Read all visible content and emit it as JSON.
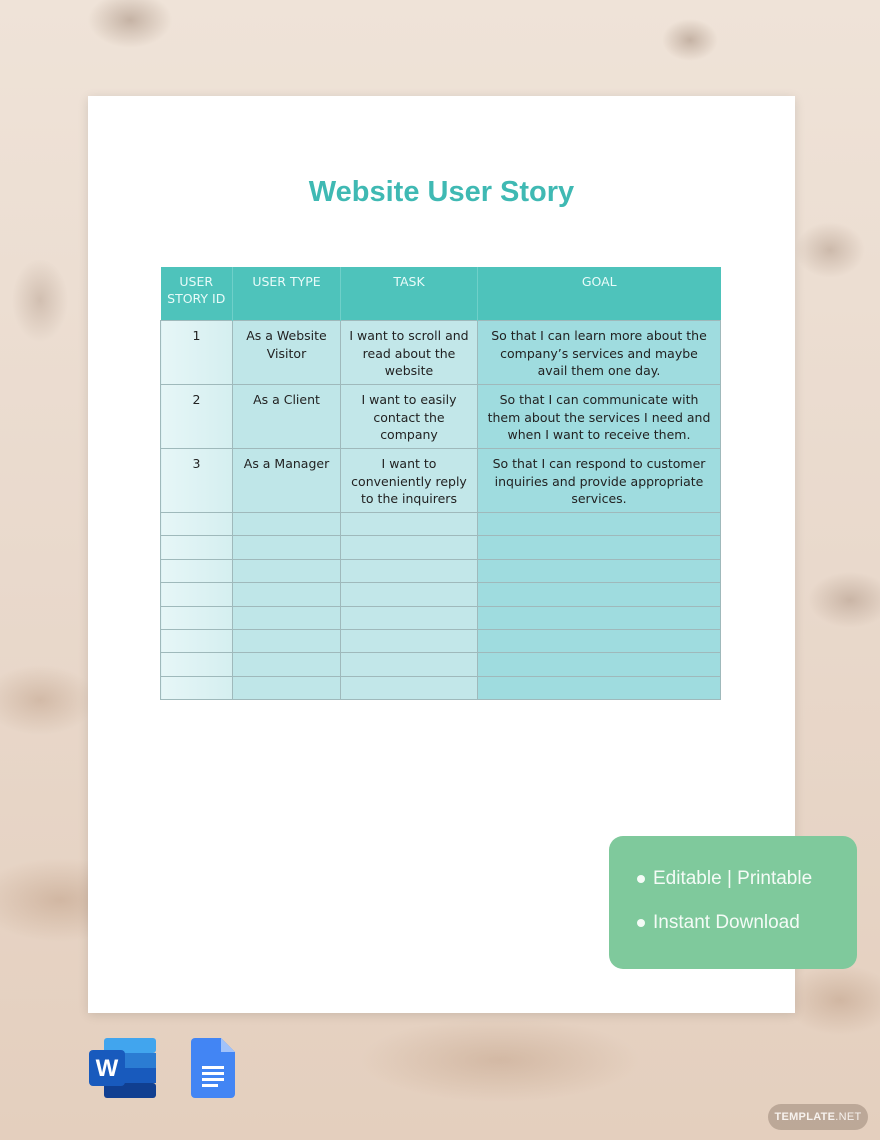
{
  "document": {
    "title": "Website User Story",
    "table": {
      "headers": [
        "USER STORY ID",
        "USER TYPE",
        "TASK",
        "GOAL"
      ],
      "rows": [
        {
          "id": "1",
          "user_type": "As a Website Visitor",
          "task": "I want to scroll and read about the website",
          "goal": "So that I can learn more about the company’s services and maybe avail them one day."
        },
        {
          "id": "2",
          "user_type": "As a Client",
          "task": "I want to easily contact the company",
          "goal": "So that I can communicate with them about the services I need and when I want to receive them."
        },
        {
          "id": "3",
          "user_type": "As a Manager",
          "task": "I want to conveniently reply to the inquirers",
          "goal": "So that I can respond to customer inquiries and provide appropriate services."
        }
      ],
      "empty_row_count": 8
    }
  },
  "badge": {
    "items": [
      "Editable | Printable",
      "Instant Download"
    ],
    "color": "#7fc99c"
  },
  "formats": {
    "word_icon": "microsoft-word-icon",
    "docs_icon": "google-docs-icon",
    "word_letter": "W"
  },
  "brand": {
    "name_bold": "TEMPLATE",
    "name_rest": ".NET"
  },
  "colors": {
    "title": "#3fb9b3",
    "header": "#4ec3bb"
  }
}
